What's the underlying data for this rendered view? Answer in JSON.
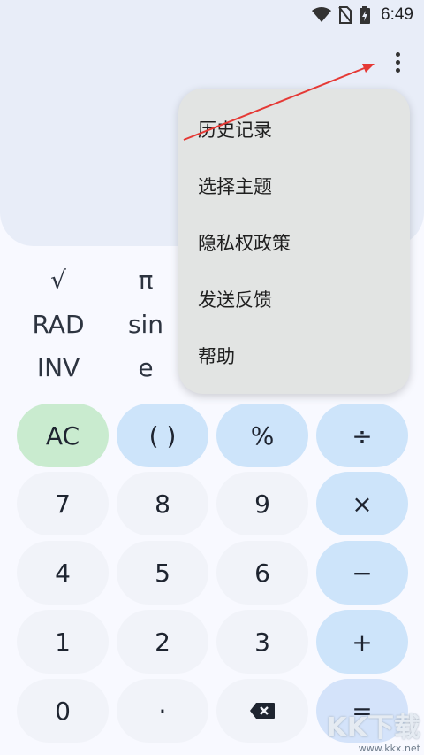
{
  "status": {
    "time": "6:49"
  },
  "scientific": {
    "row1": [
      "√",
      "π"
    ],
    "row2": [
      "RAD",
      "sin"
    ],
    "row3": [
      "INV",
      "e"
    ]
  },
  "menu": {
    "items": [
      "历史记录",
      "选择主题",
      "隐私权政策",
      "发送反馈",
      "帮助"
    ]
  },
  "keypad": {
    "row1": [
      "AC",
      "( )",
      "%",
      "÷"
    ],
    "row2": [
      "7",
      "8",
      "9",
      "×"
    ],
    "row3": [
      "4",
      "5",
      "6",
      "−"
    ],
    "row4": [
      "1",
      "2",
      "3",
      "+"
    ],
    "row5": [
      "0",
      "·",
      "⌫",
      "="
    ]
  },
  "watermark": {
    "brand": "KK下载",
    "url": "www.kkx.net"
  },
  "colors": {
    "display_bg": "#e8edf8",
    "menu_bg": "#e2e4e3",
    "operator_key": "#cde4fa",
    "clear_key": "#c9ebcf",
    "number_key": "#f1f3f9",
    "annotation_arrow": "#e53935"
  }
}
